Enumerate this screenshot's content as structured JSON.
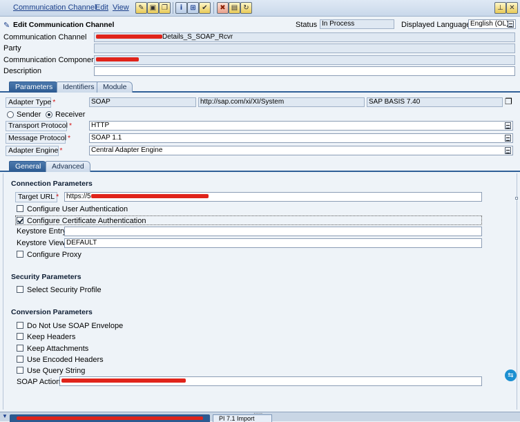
{
  "menu": {
    "communication_channel": "Communication Channel",
    "edit": "Edit",
    "view": "View"
  },
  "header": {
    "title": "Edit Communication Channel",
    "status_label": "Status",
    "status_value": "In Process",
    "language_label": "Displayed Language",
    "language_value": "English (OL)"
  },
  "object": {
    "channel_label": "Communication Channel",
    "party_label": "Party",
    "component_label": "Communication Component",
    "description_label": "Description",
    "channel_value_suffix": "Details_S_SOAP_Rcvr"
  },
  "tabs": {
    "parameters": "Parameters",
    "identifiers": "Identifiers",
    "module": "Module"
  },
  "adapter": {
    "type_label": "Adapter Type",
    "type_value": "SOAP",
    "type_namespace": "http://sap.com/xi/XI/System",
    "type_swcv": "SAP BASIS 7.40",
    "sender_label": "Sender",
    "receiver_label": "Receiver",
    "transport_label": "Transport Protocol",
    "transport_value": "HTTP",
    "message_label": "Message Protocol",
    "message_value": "SOAP 1.1",
    "engine_label": "Adapter Engine",
    "engine_value": "Central Adapter Engine"
  },
  "subtabs": {
    "general": "General",
    "advanced": "Advanced"
  },
  "connection": {
    "title": "Connection Parameters",
    "target_url_label": "Target URL",
    "target_url_prefix": "https://5",
    "user_auth_label": "Configure User Authentication",
    "cert_auth_label": "Configure Certificate Authentication",
    "keystore_entry_label": "Keystore Entry",
    "keystore_entry_value": "",
    "keystore_view_label": "Keystore View",
    "keystore_view_value": "DEFAULT",
    "proxy_label": "Configure Proxy"
  },
  "security": {
    "title": "Security Parameters",
    "profile_label": "Select Security Profile"
  },
  "conversion": {
    "title": "Conversion Parameters",
    "no_envelope_label": "Do Not Use SOAP Envelope",
    "keep_headers_label": "Keep Headers",
    "keep_attachments_label": "Keep Attachments",
    "encoded_headers_label": "Use Encoded Headers",
    "query_string_label": "Use Query String",
    "soap_action_label": "SOAP Action"
  },
  "checkbox_states": {
    "user_auth": false,
    "cert_auth": true,
    "proxy": false,
    "profile": false,
    "no_envelope": false,
    "keep_headers": false,
    "keep_attachments": false,
    "encoded_headers": false,
    "query_string": false
  },
  "direction": "Receiver",
  "bottom": {
    "tab2_label": "PI 7.1 Import"
  },
  "colors": {
    "accent": "#2c5a91",
    "required": "#d41111",
    "redaction": "#e0241b"
  },
  "icons": [
    "edit-icon",
    "save-icon",
    "copy-icon",
    "info-icon",
    "structure-icon",
    "check-icon",
    "delete-icon",
    "history-icon",
    "refresh-icon",
    "pin-icon",
    "close-icon",
    "help-icon",
    "window-icon"
  ]
}
